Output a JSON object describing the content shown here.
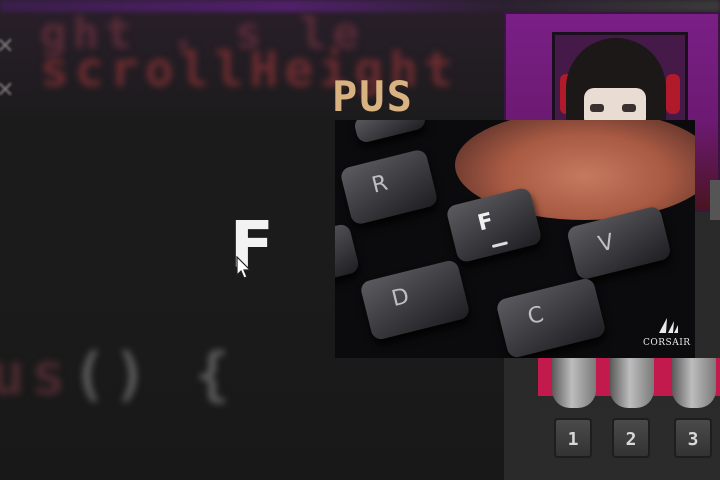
{
  "background": {
    "code_line_1": "ght . s le",
    "code_line_2": "scrollHeight",
    "code_line_3_text": "us",
    "code_line_3_paren": "() {"
  },
  "title_word": "PUS",
  "focus_letter": "F",
  "photo": {
    "keys": {
      "r": "R",
      "f": "F",
      "v": "V",
      "d": "D",
      "c": "C"
    },
    "brand": "CORSAIR"
  },
  "side_panel": {
    "keys": [
      "1",
      "2",
      "3"
    ]
  },
  "colors": {
    "title": "#d8b280",
    "panel_accent": "#c21a4d",
    "avatar_bg": "#7a1f86"
  }
}
